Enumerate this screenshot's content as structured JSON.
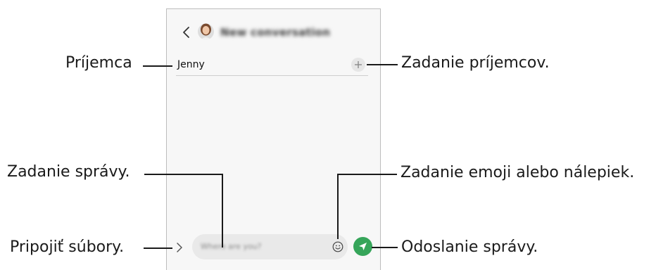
{
  "header": {
    "title": "New conversation",
    "back_icon": "chevron-left-icon",
    "avatar_icon": "profile-avatar-icon"
  },
  "recipient": {
    "name": "Jenny",
    "add_icon": "plus-icon"
  },
  "composer": {
    "placeholder": "Where are you?",
    "attach_icon": "chevron-right-icon",
    "emoji_icon": "smiley-icon",
    "send_icon": "send-arrow-icon",
    "send_color": "#36a55a"
  },
  "callouts": {
    "recipient": "Príjemca",
    "enter_recipients": "Zadanie príjemcov.",
    "enter_message": "Zadanie správy.",
    "emoji_stickers": "Zadanie emoji alebo nálepiek.",
    "attach_files": "Pripojiť súbory.",
    "send_message": "Odoslanie správy."
  }
}
